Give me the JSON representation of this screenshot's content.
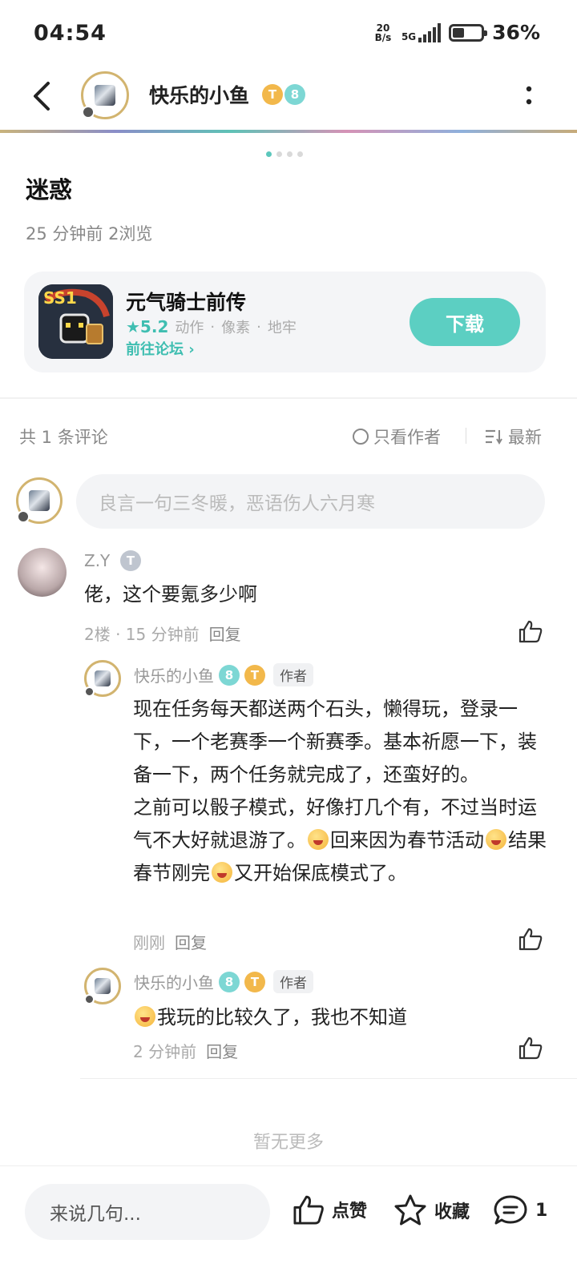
{
  "status_bar": {
    "time": "04:54",
    "net_speed_top": "20",
    "net_speed_bottom": "B/s",
    "network": "5G",
    "battery_percent": "36%",
    "battery_level": 0.36
  },
  "header": {
    "title": "快乐的小鱼",
    "badge_t": "T",
    "badge_level": "8"
  },
  "post": {
    "title": "迷惑",
    "meta": "25 分钟前  2浏览",
    "carousel_pages": 4,
    "carousel_active": 1
  },
  "game_card": {
    "name": "元气骑士前传",
    "icon_text": "SS1",
    "rating": "★5.2",
    "tags": [
      "动作",
      "像素",
      "地牢"
    ],
    "forum_link": "前往论坛 ›",
    "download": "下载"
  },
  "comments_bar": {
    "count": "共 1 条评论",
    "only_author": "只看作者",
    "sort": "最新"
  },
  "comment_input": {
    "placeholder": "良言一句三冬暖，恶语伤人六月寒"
  },
  "comments": {
    "main": {
      "name": "Z.Y",
      "badge": "T",
      "text": "佬，这个要氪多少啊",
      "meta": "2楼 · 15 分钟前",
      "reply": "回复"
    },
    "reply1": {
      "name": "快乐的小鱼",
      "badge_level": "8",
      "badge_t": "T",
      "author_tag": "作者",
      "line1": "现在任务每天都送两个石头，懒得玩，登录一下，一个老赛季一个新赛季。基本祈愿一下，装备一下，两个任务就完成了，还蛮好的。",
      "line2a": "之前可以骰子模式，好像打几个有，不过当时运气不大好就退游了。",
      "line2b": "回来因为春节活动",
      "line2c": "结果春节刚完",
      "line2d": "又开始保底模式了。",
      "meta": "刚刚",
      "reply": "回复"
    },
    "reply2": {
      "name": "快乐的小鱼",
      "badge_level": "8",
      "badge_t": "T",
      "author_tag": "作者",
      "text": "我玩的比较久了，我也不知道",
      "meta": "2 分钟前",
      "reply": "回复"
    }
  },
  "no_more": "暂无更多",
  "bottom_bar": {
    "input_placeholder": "来说几句...",
    "like": "点赞",
    "favorite": "收藏",
    "comment_count": "1"
  }
}
